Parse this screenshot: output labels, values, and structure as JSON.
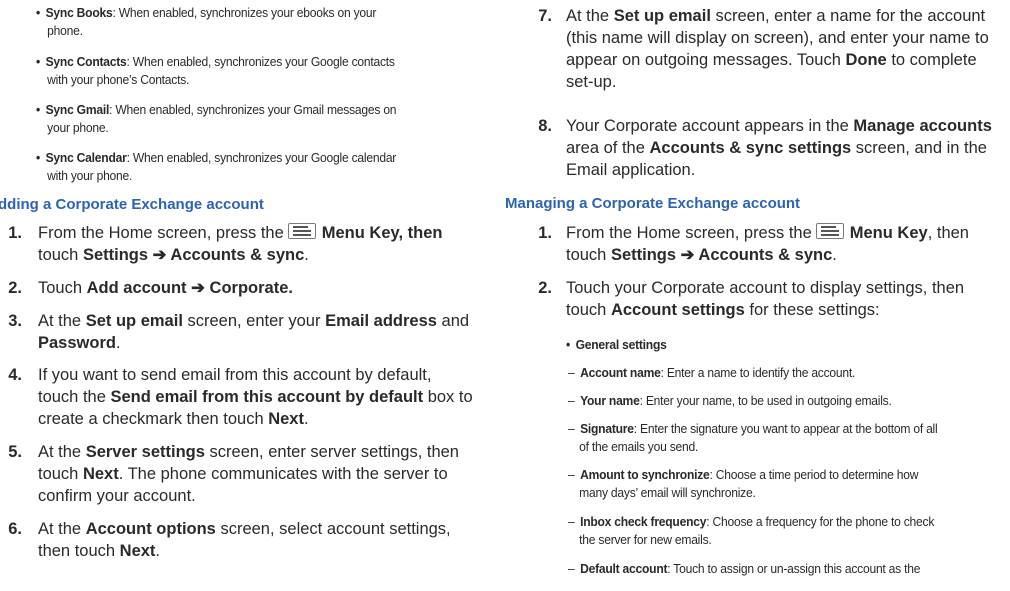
{
  "left": {
    "sync_bullets": [
      {
        "term": "Sync Books",
        "desc": ": When enabled, synchronizes your ebooks on your",
        "desc2": "phone."
      },
      {
        "term": "Sync Contacts",
        "desc": ": When enabled, synchronizes your Google contacts",
        "desc2": "with your phone’s Contacts."
      },
      {
        "term": "Sync Gmail",
        "desc": ": When enabled, synchronizes your Gmail messages on",
        "desc2": "your phone."
      },
      {
        "term": "Sync Calendar",
        "desc": ": When enabled, synchronizes your Google calendar",
        "desc2": "with your phone."
      }
    ],
    "heading": "dding a Corporate Exchange account",
    "steps": [
      {
        "n": "1.",
        "lines": [
          "From the Home screen, press the",
          "Menu Key, then"
        ],
        "line2a": "touch ",
        "line2b": "Settings ➔ Accounts & sync",
        "line2c": "."
      },
      {
        "n": "2.",
        "pre": "Touch ",
        "bold": "Add account ➔ Corporate."
      },
      {
        "n": "3.",
        "a": "At the ",
        "b": "Set up email",
        "c": " screen, enter your ",
        "d": "Email address",
        "e": " and",
        "f": "Password",
        "g": "."
      },
      {
        "n": "4.",
        "l1": "If you want to send email from this account by default,",
        "l2a": "touch the ",
        "l2b": "Send email from this account by default",
        "l2c": " box to",
        "l3a": "create a checkmark then touch ",
        "l3b": "Next",
        "l3c": "."
      },
      {
        "n": "5.",
        "l1a": "At the ",
        "l1b": "Server settings",
        "l1c": " screen, enter server settings, then",
        "l2a": "touch ",
        "l2b": "Next",
        "l2c": ". The phone communicates with the server to",
        "l3": "confirm your account."
      },
      {
        "n": "6.",
        "l1a": "At the ",
        "l1b": "Account options",
        "l1c": " screen, select account settings,",
        "l2a": "then touch ",
        "l2b": "Next",
        "l2c": "."
      }
    ]
  },
  "right": {
    "step7": {
      "n": "7.",
      "l1a": "At the ",
      "l1b": "Set up email",
      "l1c": " screen, enter a name for the account",
      "l2": "(this name will display on screen), and enter your name to",
      "l3a": "appear on outgoing messages. Touch ",
      "l3b": "Done",
      "l3c": " to complete",
      "l4": "set-up."
    },
    "step8": {
      "n": "8.",
      "l1a": "Your Corporate account appears in the ",
      "l1b": "Manage accounts",
      "l2a": "area of the ",
      "l2b": "Accounts & sync settings",
      "l2c": " screen, and in the",
      "l3": "Email application."
    },
    "heading": "Managing a Corporate Exchange account",
    "mstep1": {
      "n": "1.",
      "l1a": "From the Home screen, press the",
      "l1b": "Menu Key",
      "l1c": ", then",
      "l2a": "touch ",
      "l2b": "Settings ➔ Accounts & sync",
      "l2c": "."
    },
    "mstep2": {
      "n": "2.",
      "l1": "Touch your Corporate account to display settings, then",
      "l2a": "touch ",
      "l2b": "Account settings",
      "l2c": " for these settings:"
    },
    "general": "General settings",
    "dashes": [
      {
        "term": "Account name",
        "l1": ": Enter a name to identify the account.",
        "l2": ""
      },
      {
        "term": "Your name",
        "l1": ": Enter your name, to be used in outgoing emails.",
        "l2": ""
      },
      {
        "term": "Signature",
        "l1": ": Enter the signature you want to appear at the bottom of all",
        "l2": "of the emails you send."
      },
      {
        "term": "Amount to synchronize",
        "l1": ": Choose a time period to determine how",
        "l2": "many days’ email will synchronize."
      },
      {
        "term": "Inbox check frequency",
        "l1": ": Choose a frequency for the phone to check",
        "l2": "the server for new emails."
      },
      {
        "term": "Default account",
        "l1": ": Touch to assign or un-assign this account as the",
        "l2": ""
      }
    ]
  }
}
